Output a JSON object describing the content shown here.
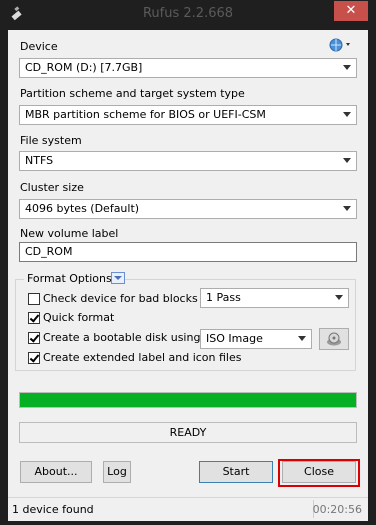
{
  "window": {
    "title": "Rufus 2.2.668",
    "close_glyph": "✕"
  },
  "device": {
    "label": "Device",
    "value": "CD_ROM (D:) [7.7GB]"
  },
  "partition": {
    "label": "Partition scheme and target system type",
    "value": "MBR partition scheme for BIOS or UEFI-CSM"
  },
  "filesystem": {
    "label": "File system",
    "value": "NTFS"
  },
  "cluster": {
    "label": "Cluster size",
    "value": "4096 bytes (Default)"
  },
  "volume": {
    "label": "New volume label",
    "value": "CD_ROM"
  },
  "format_options": {
    "title": "Format Options",
    "bad_blocks": {
      "label": "Check device for bad blocks",
      "checked": false,
      "passes": "1 Pass"
    },
    "quick_format": {
      "label": "Quick format",
      "checked": true
    },
    "bootable": {
      "label": "Create a bootable disk using",
      "checked": true,
      "source": "ISO Image"
    },
    "extended_label": {
      "label": "Create extended label and icon files",
      "checked": true
    }
  },
  "progress": {
    "fraction": 1.0,
    "color": "#06b025"
  },
  "state": "READY",
  "buttons": {
    "about": "About...",
    "log": "Log",
    "start": "Start",
    "close": "Close"
  },
  "statusbar": {
    "text": "1 device found",
    "time": "00:20:56"
  },
  "icons": {
    "app": "usb-drive-icon",
    "language": "globe-language-icon",
    "disk_image": "disk-image-icon"
  }
}
